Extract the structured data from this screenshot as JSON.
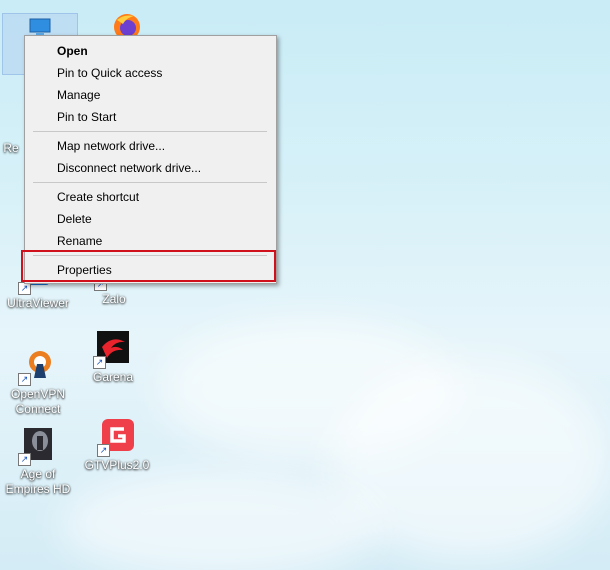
{
  "desktop": {
    "icons": [
      {
        "name": "recycle-bin",
        "label": "Re"
      },
      {
        "name": "firefox",
        "label": ""
      },
      {
        "name": "ultraviewer",
        "label": "UltraViewer"
      },
      {
        "name": "zalo",
        "label": "Zalo"
      },
      {
        "name": "openvpn",
        "label": "OpenVPN Connect"
      },
      {
        "name": "garena",
        "label": "Garena"
      },
      {
        "name": "age-of-empires",
        "label": "Age of Empires HD"
      },
      {
        "name": "gtvplus",
        "label": "GTVPlus2.0"
      }
    ]
  },
  "context_menu": {
    "items": [
      {
        "label": "Open",
        "bold": true
      },
      {
        "label": "Pin to Quick access"
      },
      {
        "label": "Manage"
      },
      {
        "label": "Pin to Start"
      },
      {
        "label": "Map network drive..."
      },
      {
        "label": "Disconnect network drive..."
      },
      {
        "label": "Create shortcut"
      },
      {
        "label": "Delete"
      },
      {
        "label": "Rename"
      },
      {
        "label": "Properties",
        "highlighted": true
      }
    ]
  },
  "colors": {
    "highlight_border": "#d0101a",
    "menu_background": "#f0f0f0"
  }
}
